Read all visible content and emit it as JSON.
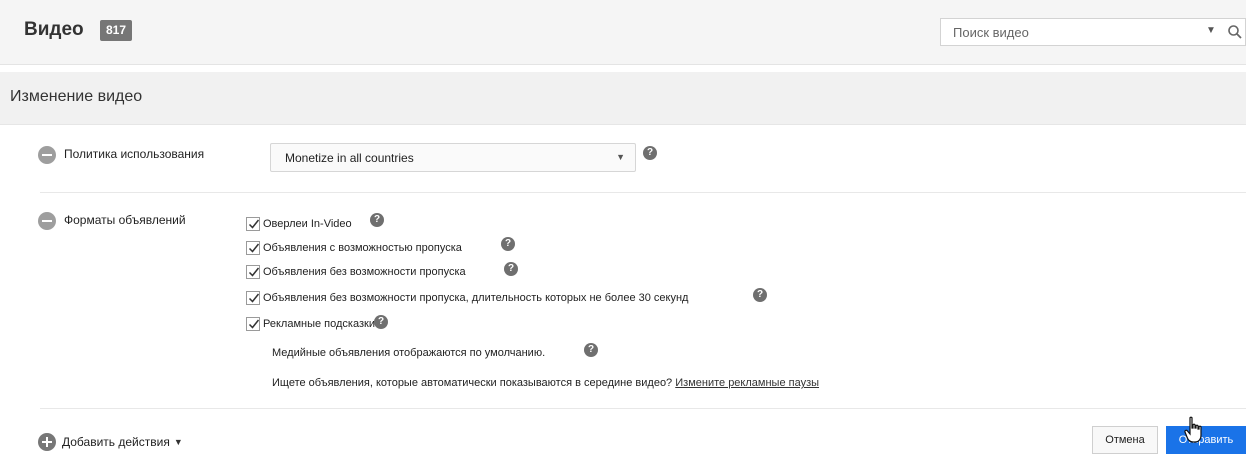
{
  "header": {
    "title": "Видео",
    "count": "817",
    "search_placeholder": "Поиск видео"
  },
  "section": {
    "title": "Изменение видео"
  },
  "usage_policy": {
    "label": "Политика использования",
    "selected": "Monetize in all countries"
  },
  "ad_formats": {
    "label": "Форматы объявлений",
    "options": [
      {
        "label": "Оверлеи In-Video",
        "checked": true
      },
      {
        "label": "Объявления с возможностью пропуска",
        "checked": true
      },
      {
        "label": "Объявления без возможности пропуска",
        "checked": true
      },
      {
        "label": "Объявления без возможности пропуска, длительность которых не более 30 секунд",
        "checked": true
      },
      {
        "label": "Рекламные подсказки",
        "checked": true
      }
    ],
    "display_note": "Медийные объявления отображаются по умолчанию.",
    "midroll_question": "Ищете объявления, которые автоматически показываются в середине видео?",
    "midroll_link": "Измените рекламные паузы"
  },
  "footer": {
    "add_actions": "Добавить действия",
    "cancel": "Отмена",
    "submit": "Отправить"
  },
  "colors": {
    "primary": "#1a73e8",
    "badge": "#767676",
    "header_bg": "#f5f5f5",
    "section_bg": "#f1f1f1"
  }
}
